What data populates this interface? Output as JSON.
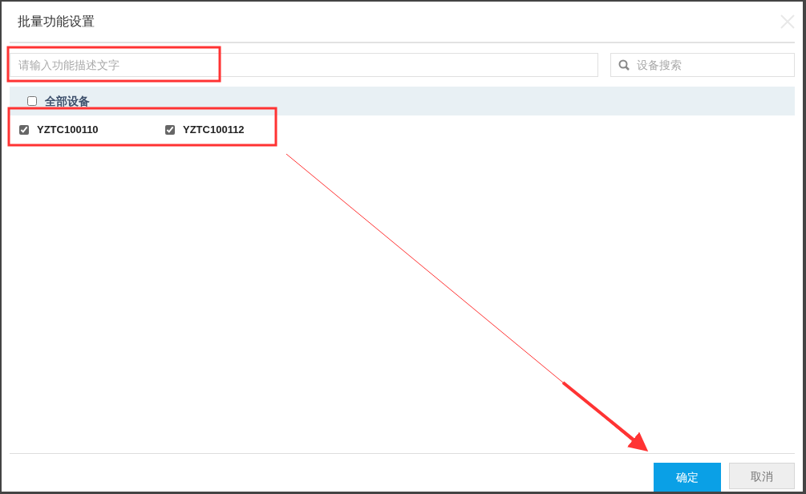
{
  "dialog": {
    "title": "批量功能设置"
  },
  "description_field": {
    "placeholder": "请输入功能描述文字"
  },
  "search": {
    "placeholder": "设备搜索"
  },
  "all_devices": {
    "label": "全部设备",
    "checked": false
  },
  "devices": [
    {
      "label": "YZTC100110",
      "checked": true
    },
    {
      "label": "YZTC100112",
      "checked": true
    }
  ],
  "buttons": [
    {
      "label": "确定",
      "kind": "primary"
    },
    {
      "label": "取消",
      "kind": "secondary"
    }
  ]
}
